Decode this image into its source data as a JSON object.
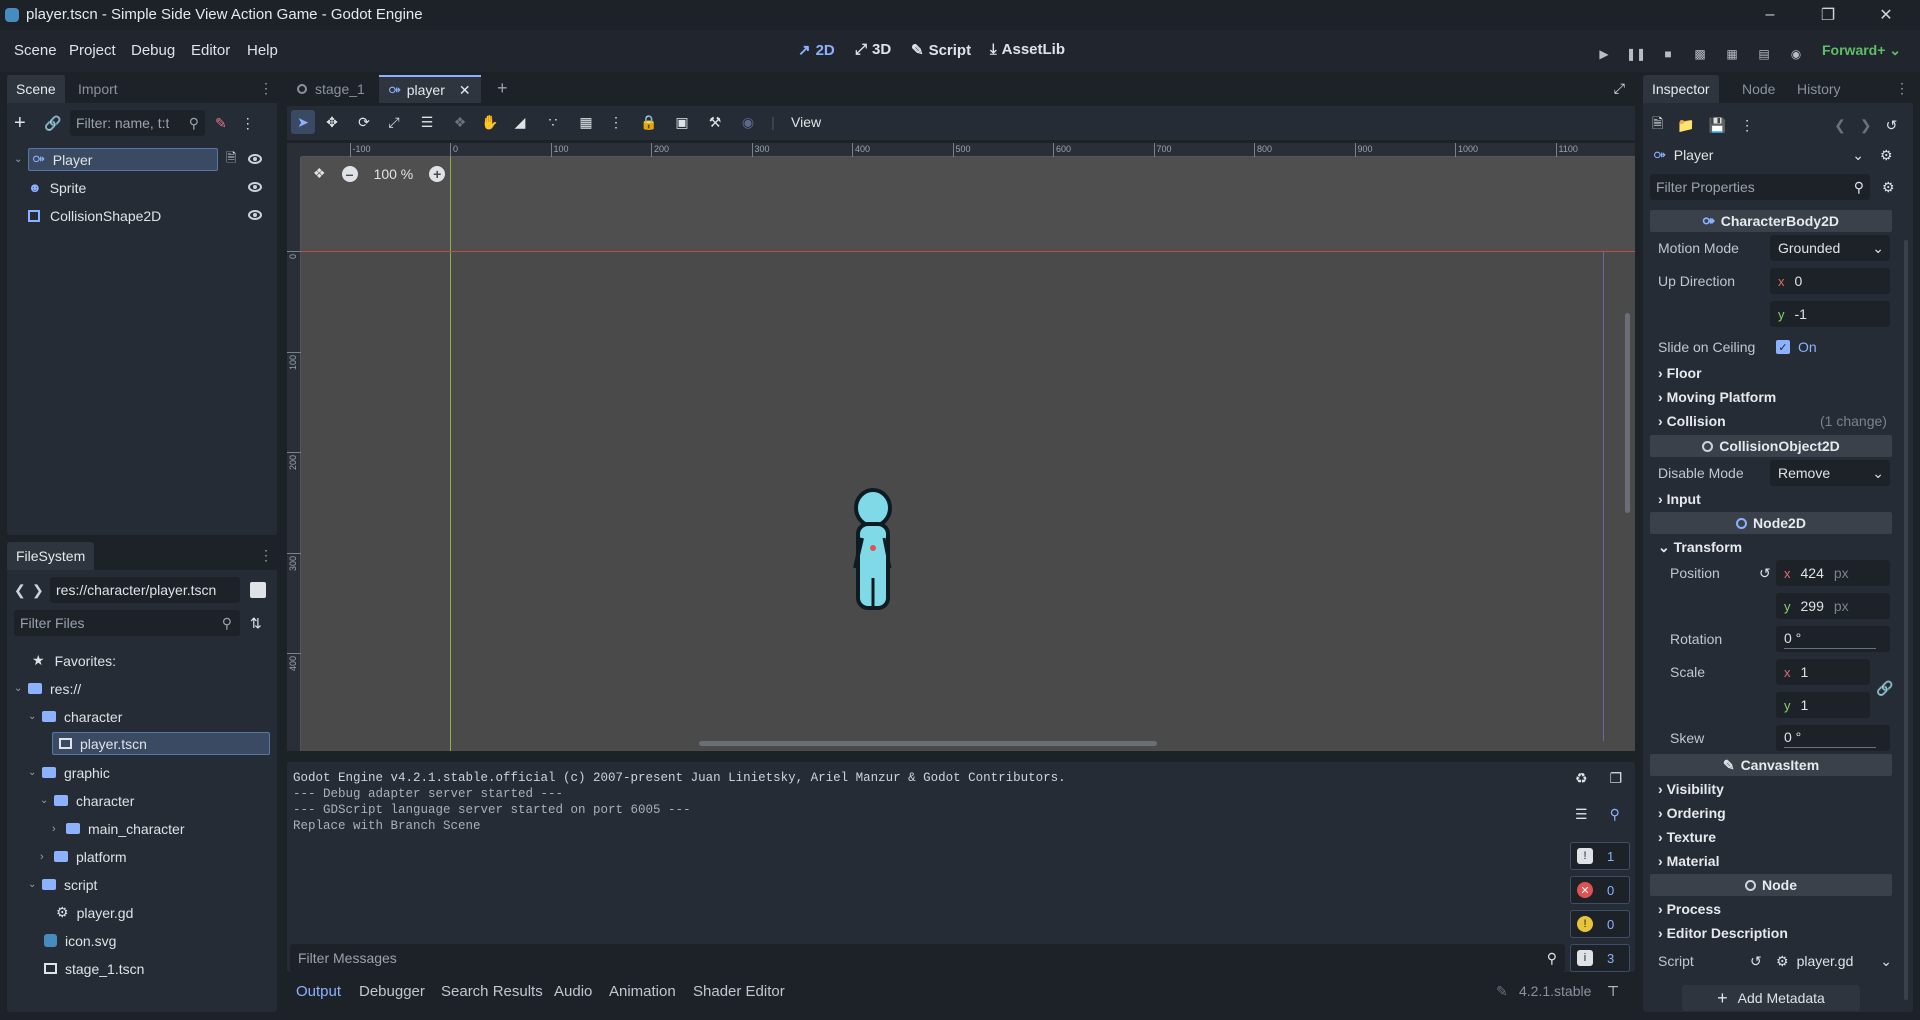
{
  "window": {
    "title": "player.tscn - Simple Side View Action Game - Godot Engine"
  },
  "menubar": {
    "menus": [
      "Scene",
      "Project",
      "Debug",
      "Editor",
      "Help"
    ],
    "main_tabs": [
      "2D",
      "3D",
      "Script",
      "AssetLib"
    ],
    "renderer": "Forward+"
  },
  "scene_dock": {
    "tabs": [
      "Scene",
      "Import"
    ],
    "filter_placeholder": "Filter: name, t:t",
    "nodes": [
      {
        "label": "Player",
        "icon": "character-body-icon"
      },
      {
        "label": "Sprite",
        "icon": "sprite-icon"
      },
      {
        "label": "CollisionShape2D",
        "icon": "collision-shape-icon"
      }
    ]
  },
  "filesystem_dock": {
    "tab": "FileSystem",
    "path": "res://character/player.tscn",
    "filter_placeholder": "Filter Files",
    "favorites_label": "Favorites:",
    "items": [
      {
        "label": "res://",
        "type": "folder"
      },
      {
        "label": "character",
        "type": "folder"
      },
      {
        "label": "player.tscn",
        "type": "scene"
      },
      {
        "label": "graphic",
        "type": "folder"
      },
      {
        "label": "character",
        "type": "folder"
      },
      {
        "label": "main_character",
        "type": "folder"
      },
      {
        "label": "platform",
        "type": "folder"
      },
      {
        "label": "script",
        "type": "folder"
      },
      {
        "label": "player.gd",
        "type": "script"
      },
      {
        "label": "icon.svg",
        "type": "image"
      },
      {
        "label": "stage_1.tscn",
        "type": "scene"
      }
    ]
  },
  "editor_tabs": [
    "stage_1",
    "player"
  ],
  "toolbar": {
    "view_label": "View",
    "zoom": "100 %"
  },
  "ruler": {
    "h_ticks": [
      "-100",
      "0",
      "100",
      "200",
      "300",
      "400",
      "500",
      "600",
      "700",
      "800",
      "900",
      "1000",
      "1100"
    ],
    "v_ticks": [
      "0",
      "100",
      "200",
      "300",
      "400"
    ]
  },
  "inspector": {
    "tabs": [
      "Inspector",
      "Node",
      "History"
    ],
    "node_name": "Player",
    "filter_placeholder": "Filter Properties",
    "sections": {
      "character_body": "CharacterBody2D",
      "collision_object": "CollisionObject2D",
      "node2d": "Node2D",
      "canvas_item": "CanvasItem",
      "node": "Node"
    },
    "props": {
      "motion_mode_label": "Motion Mode",
      "motion_mode_value": "Grounded",
      "up_direction_label": "Up Direction",
      "up_x": "0",
      "up_y": "-1",
      "slide_label": "Slide on Ceiling",
      "slide_value": "On",
      "floor": "Floor",
      "moving_platform": "Moving Platform",
      "collision": "Collision",
      "collision_changes": "(1 change)",
      "disable_mode_label": "Disable Mode",
      "disable_mode_value": "Remove",
      "input": "Input",
      "transform": "Transform",
      "position_label": "Position",
      "pos_x": "424",
      "pos_y": "299",
      "px_unit": "px",
      "rotation_label": "Rotation",
      "rotation_value": "0 °",
      "scale_label": "Scale",
      "scale_x": "1",
      "scale_y": "1",
      "skew_label": "Skew",
      "skew_value": "0 °",
      "visibility": "Visibility",
      "ordering": "Ordering",
      "texture": "Texture",
      "material": "Material",
      "process": "Process",
      "editor_description": "Editor Description",
      "script_label": "Script",
      "script_value": "player.gd",
      "add_metadata": "Add Metadata"
    }
  },
  "console": {
    "lines": [
      "Godot Engine v4.2.1.stable.official (c) 2007-present Juan Linietsky, Ariel Manzur & Godot Contributors.",
      "--- Debug adapter server started ---",
      "--- GDScript language server started on port 6005 ---",
      "Replace with Branch Scene"
    ],
    "filter_placeholder": "Filter Messages",
    "counts": {
      "messages": "1",
      "errors": "0",
      "warnings": "0",
      "info": "3"
    }
  },
  "bottom_tabs": [
    "Output",
    "Debugger",
    "Search Results",
    "Audio",
    "Animation",
    "Shader Editor"
  ],
  "version": "4.2.1.stable",
  "colors": {
    "accent": "#8cb2ff",
    "selection": "#3a4a62",
    "viewport_bg": "#4a4a4a",
    "error": "#e05252",
    "warning": "#e8c43c"
  }
}
